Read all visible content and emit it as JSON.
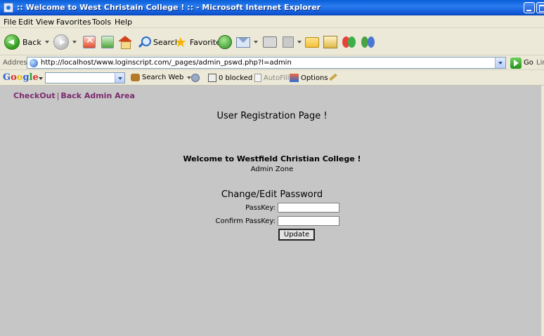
{
  "window": {
    "title": ":: Welcome to West Christain College ! :: - Microsoft Internet Explorer"
  },
  "menu": {
    "items": [
      "File",
      "Edit",
      "View",
      "Favorites",
      "Tools",
      "Help"
    ]
  },
  "toolbar": {
    "back_label": "Back",
    "search_label": "Search",
    "favorites_label": "Favorites"
  },
  "address": {
    "label": "Address",
    "url": "http://localhost/www.loginscript.com/_pages/admin_pswd.php?l=admin",
    "go_label": "Go",
    "links_label": "Lin"
  },
  "google": {
    "logo": [
      "G",
      "o",
      "o",
      "g",
      "l",
      "e"
    ],
    "search_web_label": "Search Web",
    "blocked_label": "0 blocked",
    "autofill_label": "AutoFill",
    "options_label": "Options"
  },
  "page": {
    "checkout_link": "CheckOut",
    "link_separator": "|",
    "back_admin_link": "Back Admin Area",
    "heading": "User Registration Page !",
    "welcome": "Welcome to Westfield Christian College !",
    "zone": "Admin Zone",
    "form_heading": "Change/Edit Password",
    "passkey_label": "PassKey:",
    "confirm_label": "Confirm PassKey:",
    "update_button": "Update"
  }
}
